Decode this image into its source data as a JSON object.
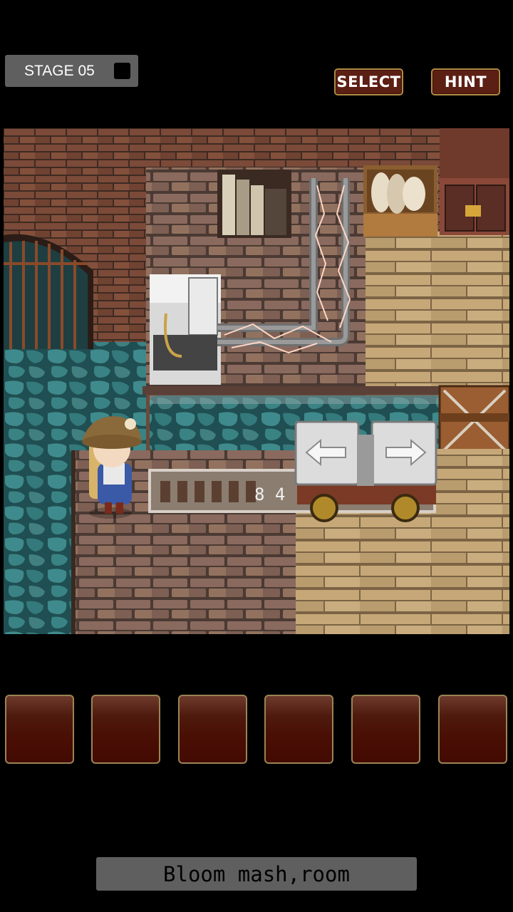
{
  "header": {
    "stage_label": "STAGE 05",
    "select_label": "SELECT",
    "hint_label": "HINT"
  },
  "scene": {
    "counter_text": "8 4"
  },
  "inventory": {
    "slots": [
      "",
      "",
      "",
      "",
      "",
      ""
    ]
  },
  "message": {
    "text": "Bloom mash,room"
  },
  "colors": {
    "button_bg": "#5c1f14",
    "button_border": "#b08a45",
    "slot_border": "#9a8454",
    "badge_bg": "#5f5f5f",
    "water": "#2d6b6e"
  }
}
